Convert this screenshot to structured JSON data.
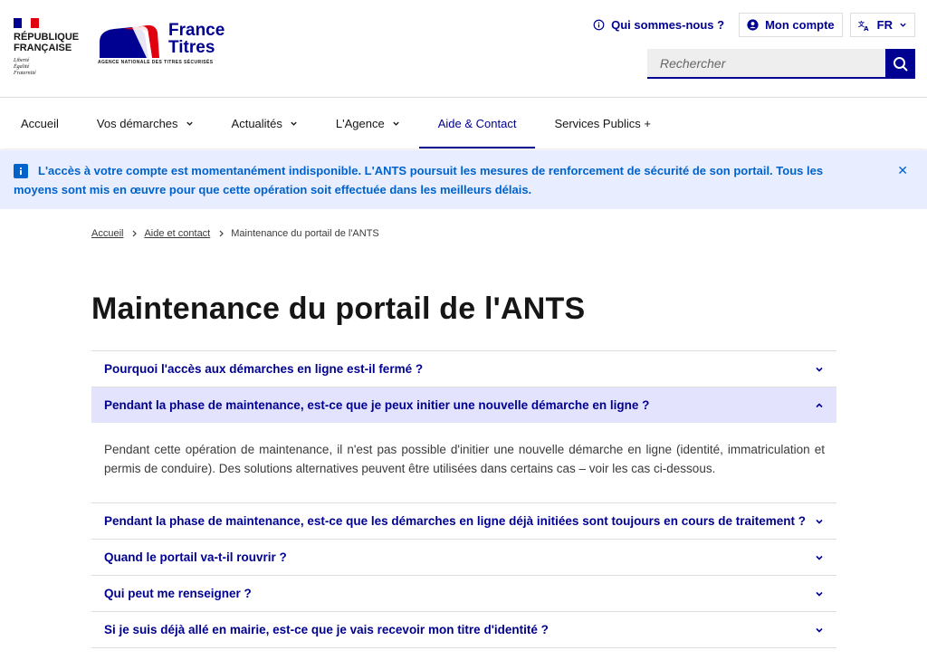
{
  "header": {
    "republique": "RÉPUBLIQUE\nFRANÇAISE",
    "motto": "Liberté\nÉgalité\nFraternité",
    "brand_name": "France\nTitres",
    "brand_tagline": "AGENCE NATIONALE DES TITRES SÉCURISÉS",
    "about_label": "Qui sommes-nous ?",
    "account_label": "Mon compte",
    "lang_label": "FR",
    "search_placeholder": "Rechercher"
  },
  "nav": {
    "items": [
      {
        "label": "Accueil"
      },
      {
        "label": "Vos démarches"
      },
      {
        "label": "Actualités"
      },
      {
        "label": "L'Agence"
      },
      {
        "label": "Aide & Contact"
      },
      {
        "label": "Services Publics +"
      }
    ]
  },
  "notice": {
    "text": "L'accès à votre compte est momentanément indisponible. L'ANTS poursuit les mesures de renforcement de sécurité de son portail. Tous les moyens sont mis en œuvre pour que cette opération soit effectuée dans les meilleurs délais.",
    "close": "✕"
  },
  "breadcrumb": {
    "items": [
      "Accueil",
      "Aide et contact",
      "Maintenance du portail de l'ANTS"
    ]
  },
  "page": {
    "title": "Maintenance du portail de l'ANTS"
  },
  "accordion": {
    "items": [
      {
        "question": "Pourquoi l'accès aux démarches en ligne est-il fermé ?"
      },
      {
        "question": "Pendant la phase de maintenance, est-ce que je peux initier une nouvelle démarche en ligne ?",
        "answer": "Pendant cette opération de maintenance, il n'est pas possible d'initier une nouvelle démarche en ligne (identité, immatriculation et permis de conduire). Des solutions alternatives peuvent être utilisées dans certains cas – voir les cas ci-dessous."
      },
      {
        "question": "Pendant la phase de maintenance, est-ce que les démarches en ligne déjà initiées sont toujours en cours de traitement ?"
      },
      {
        "question": "Quand le portail va-t-il rouvrir ?"
      },
      {
        "question": "Qui peut me renseigner ?"
      },
      {
        "question": "Si je suis déjà allé en mairie, est-ce que je vais recevoir mon titre d'identité ?"
      }
    ]
  },
  "colors": {
    "primary": "#000091",
    "info": "#0063cb",
    "info_bg": "#e8edff",
    "open_bg": "#e3e3fd",
    "marianne_red": "#e1000f"
  }
}
